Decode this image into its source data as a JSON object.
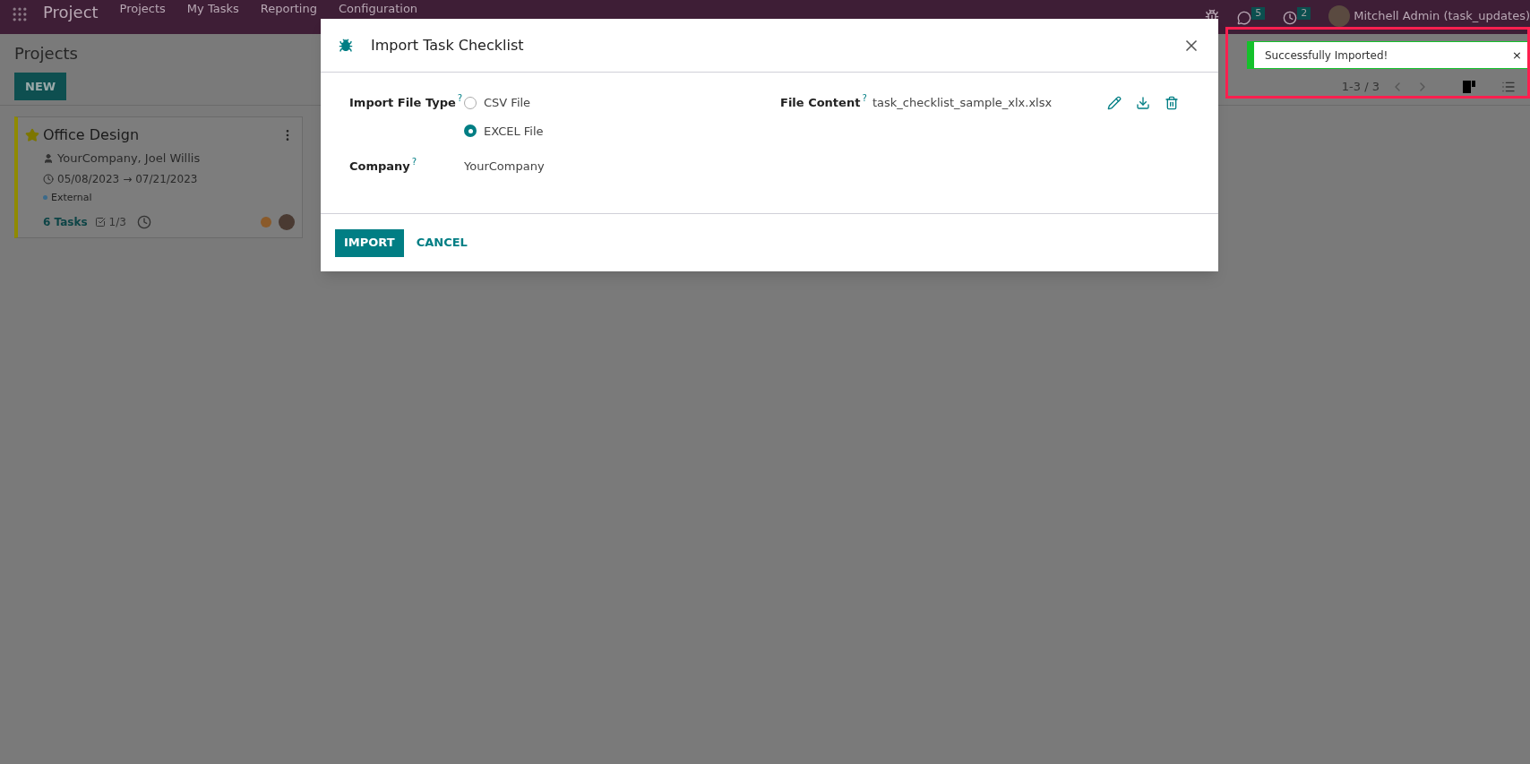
{
  "navbar": {
    "app": "Project",
    "menu": [
      "Projects",
      "My Tasks",
      "Reporting",
      "Configuration"
    ],
    "chat_count": "5",
    "activity_count": "2",
    "user": "Mitchell Admin (task_updates)"
  },
  "control_panel": {
    "title": "Projects",
    "new_button": "NEW",
    "pager": "1-3 / 3",
    "views": [
      {
        "kind": "kanban",
        "selected": true
      },
      {
        "kind": "list",
        "selected": false
      }
    ]
  },
  "cards": [
    {
      "name": "Office Design",
      "favorite": true,
      "customer": "YourCompany, Joel Willis",
      "date_start": "05/08/2023",
      "arrow": "→",
      "date_end": "07/21/2023",
      "tag": "External",
      "tasks": "6 Tasks",
      "checklist": "1/3"
    }
  ],
  "dialog": {
    "title": "Import Task Checklist",
    "file_type": {
      "label": "Import File Type",
      "help": "?",
      "options": [
        {
          "label": "CSV File",
          "selected": false
        },
        {
          "label": "EXCEL File",
          "selected": true
        }
      ]
    },
    "company": {
      "label": "Company",
      "help": "?",
      "value": "YourCompany"
    },
    "file_content": {
      "label": "File Content",
      "help": "?",
      "value": "task_checklist_sample_xlx.xlsx"
    },
    "buttons": [
      {
        "label": "IMPORT",
        "kind": "primary"
      },
      {
        "label": "CANCEL",
        "kind": "secondary"
      }
    ]
  },
  "notification": {
    "message": "Successfully Imported!",
    "close": "×"
  }
}
